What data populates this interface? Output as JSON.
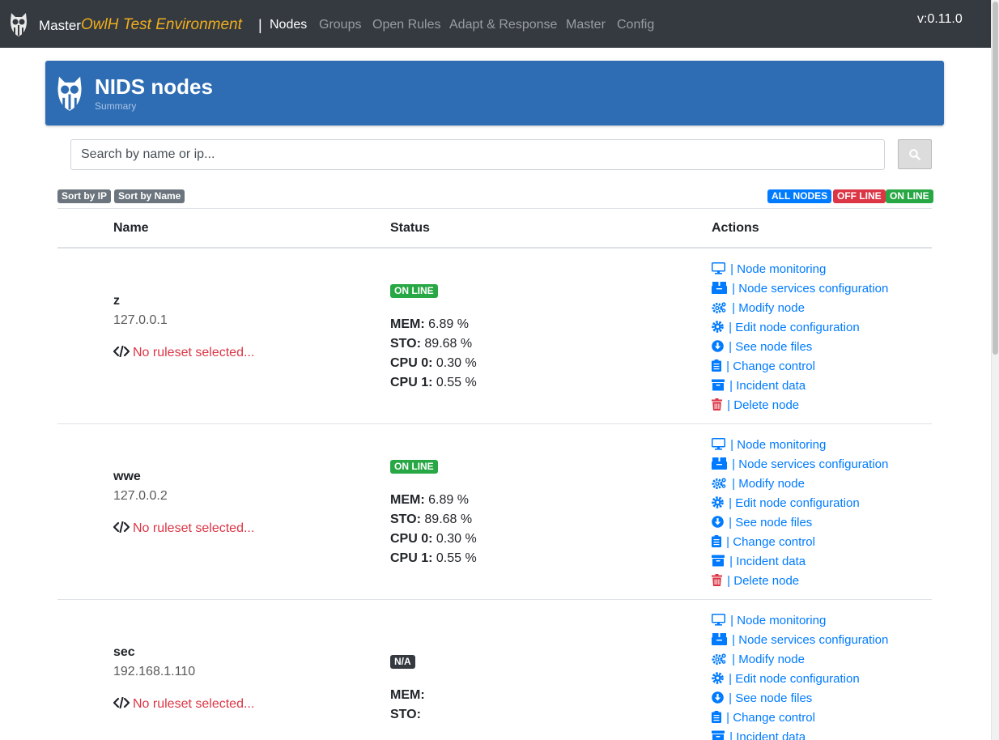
{
  "navbar": {
    "brand_prefix": "Master",
    "brand_env": "OwlH Test Environment",
    "separator": "|",
    "links": [
      "Nodes",
      "Groups",
      "Open Rules",
      "Adapt & Response",
      "Master",
      "Config"
    ],
    "active_link": "Nodes",
    "version": "v:0.11.0"
  },
  "banner": {
    "title": "NIDS nodes",
    "subtitle": "Summary",
    "background_color": "#2e6db4"
  },
  "search": {
    "placeholder": "Search by name or ip...",
    "button_icon": "search-icon"
  },
  "sort_buttons": [
    "Sort by IP",
    "Sort by Name"
  ],
  "filters": {
    "all": "ALL NODES",
    "off": "OFF LINE",
    "on": "ON LINE"
  },
  "table": {
    "headers": [
      "Name",
      "Status",
      "Actions"
    ]
  },
  "action_labels": [
    "| Node monitoring",
    "| Node services configuration",
    "| Modify node",
    "| Edit node configuration",
    "| See node files",
    "| Change control",
    "| Incident data",
    "| Delete node"
  ],
  "nodes": [
    {
      "name": "z",
      "ip": "127.0.0.1",
      "ruleset": "No ruleset selected...",
      "status": "ON LINE",
      "metrics": [
        {
          "label": "MEM:",
          "value": "6.89 %"
        },
        {
          "label": "STO:",
          "value": "89.68 %"
        },
        {
          "label": "CPU 0:",
          "value": "0.30 %"
        },
        {
          "label": "CPU 1:",
          "value": "0.55 %"
        }
      ]
    },
    {
      "name": "wwe",
      "ip": "127.0.0.2",
      "ruleset": "No ruleset selected...",
      "status": "ON LINE",
      "metrics": [
        {
          "label": "MEM:",
          "value": "6.89 %"
        },
        {
          "label": "STO:",
          "value": "89.68 %"
        },
        {
          "label": "CPU 0:",
          "value": "0.30 %"
        },
        {
          "label": "CPU 1:",
          "value": "0.55 %"
        }
      ]
    },
    {
      "name": "sec",
      "ip": "192.168.1.110",
      "ruleset": "No ruleset selected...",
      "status": "N/A",
      "metrics": [
        {
          "label": "MEM:",
          "value": ""
        },
        {
          "label": "STO:",
          "value": ""
        }
      ]
    }
  ],
  "colors": {
    "navbar": "#343a40",
    "accent": "#f0ad1c",
    "link": "#007bff",
    "danger": "#dc3545",
    "success": "#28a745"
  }
}
